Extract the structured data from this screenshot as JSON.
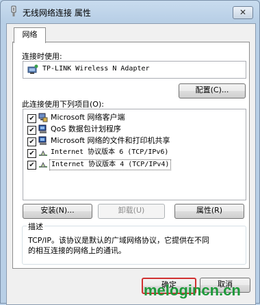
{
  "window": {
    "title": "无线网络连接 属性",
    "close_glyph": "✕"
  },
  "tabs": [
    {
      "label": "网络",
      "active": true
    }
  ],
  "connect_using": {
    "label": "连接时使用:",
    "adapter_name": "TP-LINK Wireless N Adapter",
    "configure_button": "配置(C)..."
  },
  "items_section": {
    "label": "此连接使用下列项目(O):",
    "items": [
      {
        "checked": true,
        "icon": "network-client-icon",
        "text": "Microsoft 网络客户端"
      },
      {
        "checked": true,
        "icon": "qos-scheduler-icon",
        "text": "QoS 数据包计划程序"
      },
      {
        "checked": true,
        "icon": "file-sharing-icon",
        "text": "Microsoft 网络的文件和打印机共享"
      },
      {
        "checked": true,
        "icon": "protocol-icon",
        "text": "Internet 协议版本 6 (TCP/IPv6)"
      },
      {
        "checked": true,
        "icon": "protocol-icon",
        "text": "Internet 协议版本 4 (TCP/IPv4)",
        "selected": true
      }
    ]
  },
  "buttons": {
    "install": "安装(N)...",
    "uninstall": "卸载(U)",
    "properties": "属性(R)"
  },
  "description": {
    "label": "描述",
    "text_line1": "TCP/IP。该协议是默认的广域网络协议，它提供在不同",
    "text_line2": "的相互连接的网络上的通讯。"
  },
  "footer": {
    "ok": "确定",
    "cancel": "取消"
  },
  "watermark": "melogincn.cn",
  "colors": {
    "frame": "#b8cfe6",
    "selection": "#3399ff",
    "ok_highlight": "#d03030"
  }
}
